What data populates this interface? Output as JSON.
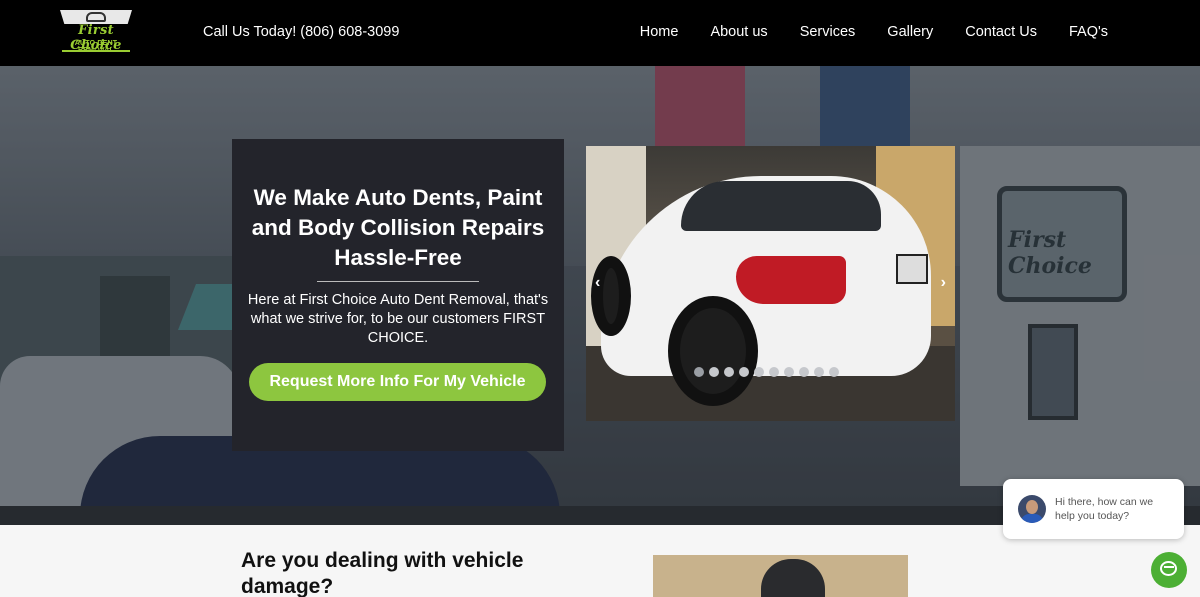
{
  "header": {
    "logo": {
      "script_text": "First Choice",
      "sub_text": "AUTO DENT REMOVAL"
    },
    "phone": "Call Us Today! (806) 608-3099",
    "nav": [
      "Home",
      "About us",
      "Services",
      "Gallery",
      "Contact Us",
      "FAQ's"
    ]
  },
  "hero": {
    "sign_text": "First Choice",
    "panel": {
      "title": "We Make Auto Dents, Paint and Body Collision Repairs Hassle-Free",
      "text": "Here at First Choice Auto Dent Removal, that's what we strive for, to be our customers FIRST CHOICE.",
      "cta": "Request More Info For My Vehicle"
    },
    "carousel": {
      "prev": "‹",
      "next": "›",
      "slide_count": 10,
      "active_index": 0
    }
  },
  "section": {
    "heading": "Are you dealing with vehicle damage?"
  },
  "chat": {
    "message": "Hi there, how can we help you today?"
  },
  "colors": {
    "header_bg": "#000000",
    "accent_green": "#8dc63f",
    "panel_bg": "#23242b",
    "chat_green": "#4caf34"
  }
}
